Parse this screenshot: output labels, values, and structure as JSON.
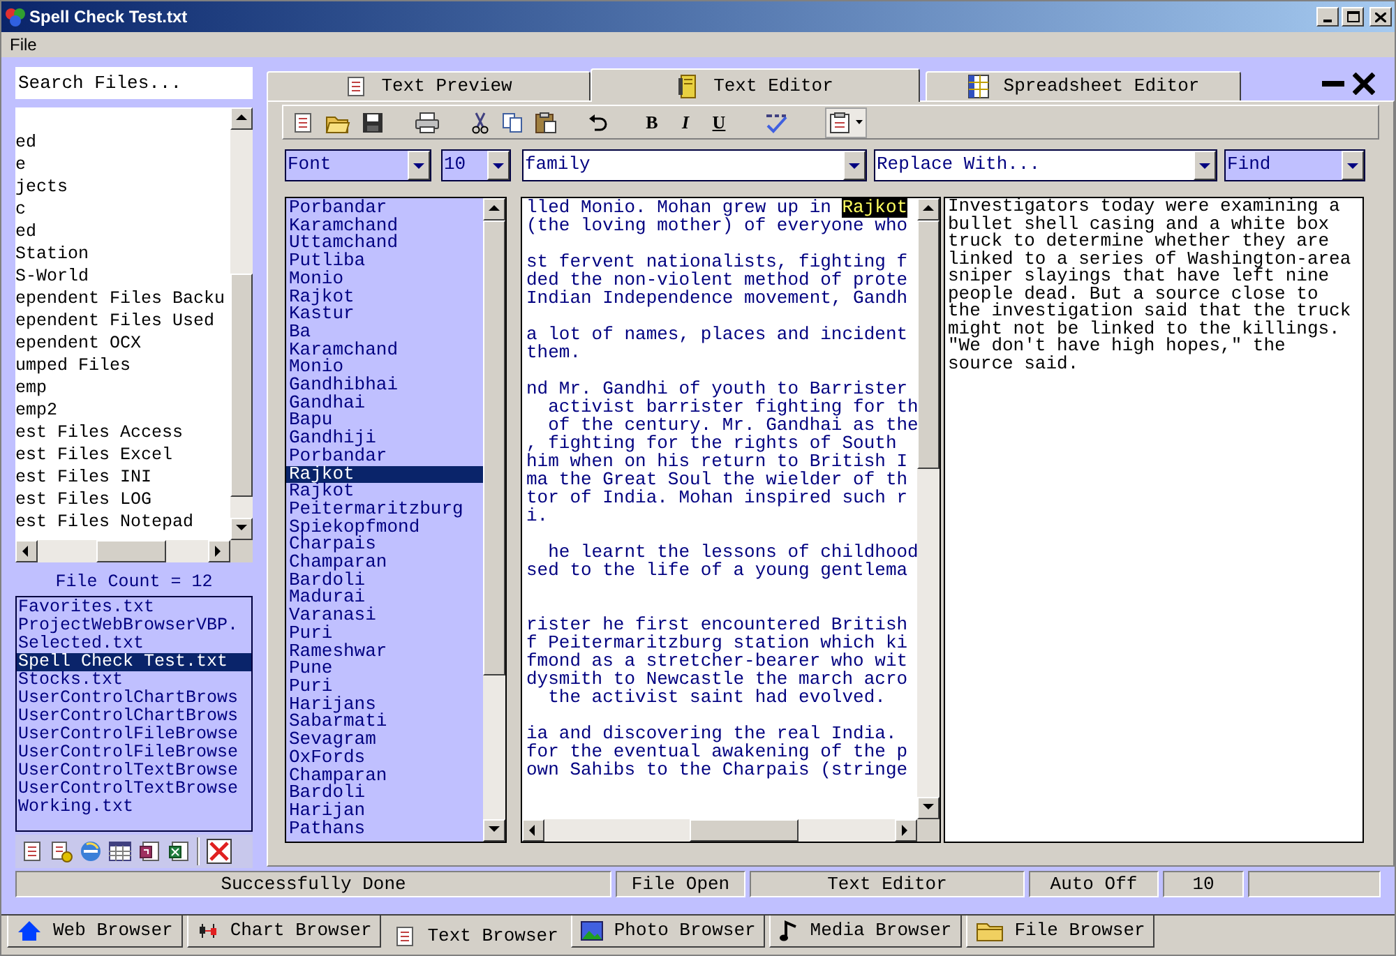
{
  "window": {
    "title": "Spell Check Test.txt"
  },
  "menu": [
    "File"
  ],
  "search": {
    "placeholder": "Search Files..."
  },
  "folder_tree": [
    "ed",
    "e",
    "jects",
    "c",
    "ed",
    "Station",
    "S-World",
    "ependent Files Backu",
    "ependent Files Used",
    "ependent OCX",
    "umped Files",
    "emp",
    "emp2",
    "est Files Access",
    "est Files Excel",
    "est Files INI",
    "est Files LOG",
    "est Files Notepad"
  ],
  "file_count": "File Count = 12",
  "files": [
    {
      "name": "Favorites.txt",
      "selected": false
    },
    {
      "name": "ProjectWebBrowserVBP.",
      "selected": false
    },
    {
      "name": "Selected.txt",
      "selected": false
    },
    {
      "name": "Spell Check Test.txt",
      "selected": true
    },
    {
      "name": "Stocks.txt",
      "selected": false
    },
    {
      "name": "UserControlChartBrows",
      "selected": false
    },
    {
      "name": "UserControlChartBrows",
      "selected": false
    },
    {
      "name": "UserControlFileBrowse",
      "selected": false
    },
    {
      "name": "UserControlFileBrowse",
      "selected": false
    },
    {
      "name": "UserControlTextBrowse",
      "selected": false
    },
    {
      "name": "UserControlTextBrowse",
      "selected": false
    },
    {
      "name": "Working.txt",
      "selected": false
    }
  ],
  "editor_tabs": [
    {
      "label": "Text Preview",
      "selected": false
    },
    {
      "label": "Text Editor",
      "selected": true
    },
    {
      "label": "Spreadsheet Editor",
      "selected": false
    }
  ],
  "format_buttons": [
    "B",
    "I",
    "U"
  ],
  "font_combo": "Font",
  "size_combo": "10",
  "find_text": "family",
  "replace_text": "Replace With...",
  "find_combo": "Find",
  "word_list": [
    {
      "word": "Porbandar",
      "selected": false
    },
    {
      "word": "Karamchand",
      "selected": false
    },
    {
      "word": "Uttamchand",
      "selected": false
    },
    {
      "word": "Putliba",
      "selected": false
    },
    {
      "word": "Monio",
      "selected": false
    },
    {
      "word": "Rajkot",
      "selected": false
    },
    {
      "word": "Kastur",
      "selected": false
    },
    {
      "word": "Ba",
      "selected": false
    },
    {
      "word": "Karamchand",
      "selected": false
    },
    {
      "word": "Monio",
      "selected": false
    },
    {
      "word": "Gandhibhai",
      "selected": false
    },
    {
      "word": "Gandhai",
      "selected": false
    },
    {
      "word": "Bapu",
      "selected": false
    },
    {
      "word": "Gandhiji",
      "selected": false
    },
    {
      "word": "Porbandar",
      "selected": false
    },
    {
      "word": "Rajkot",
      "selected": true
    },
    {
      "word": "Rajkot",
      "selected": false
    },
    {
      "word": "Peitermaritzburg",
      "selected": false
    },
    {
      "word": "Spiekopfmond",
      "selected": false
    },
    {
      "word": "Charpais",
      "selected": false
    },
    {
      "word": "Champaran",
      "selected": false
    },
    {
      "word": "Bardoli",
      "selected": false
    },
    {
      "word": "Madurai",
      "selected": false
    },
    {
      "word": "Varanasi",
      "selected": false
    },
    {
      "word": "Puri",
      "selected": false
    },
    {
      "word": "Rameshwar",
      "selected": false
    },
    {
      "word": "Pune",
      "selected": false
    },
    {
      "word": "Puri",
      "selected": false
    },
    {
      "word": "Harijans",
      "selected": false
    },
    {
      "word": "Sabarmati",
      "selected": false
    },
    {
      "word": "Sevagram",
      "selected": false
    },
    {
      "word": "OxFords",
      "selected": false
    },
    {
      "word": "Champaran",
      "selected": false
    },
    {
      "word": "Bardoli",
      "selected": false
    },
    {
      "word": "Harijan",
      "selected": false
    },
    {
      "word": "Pathans",
      "selected": false
    }
  ],
  "editor_paragraphs": [
    {
      "extra_gap": false,
      "lines": [
        {
          "text": "lled Monio. Mohan grew up in ",
          "highlight": "Rajkot"
        },
        {
          "text": "(the loving mother) of everyone who"
        }
      ]
    },
    {
      "extra_gap": false,
      "lines": [
        {
          "text": "st fervent nationalists, fighting f"
        },
        {
          "text": "ded the non-violent method of prote"
        },
        {
          "text": "Indian Independence movement, Gandh"
        }
      ]
    },
    {
      "extra_gap": false,
      "lines": [
        {
          "text": "a lot of names, places and incident"
        },
        {
          "text": "them."
        }
      ]
    },
    {
      "extra_gap": false,
      "lines": [
        {
          "text": "nd Mr. Gandhi of youth to Barrister"
        },
        {
          "text": "  activist barrister fighting for th"
        },
        {
          "text": "  of the century. Mr. Gandhai as the"
        },
        {
          "text": ", fighting for the rights of South"
        },
        {
          "text": "him when on his return to British I"
        },
        {
          "text": "ma the Great Soul the wielder of th"
        },
        {
          "text": "tor of India. Mohan inspired such r"
        },
        {
          "text": "i."
        }
      ]
    },
    {
      "extra_gap": false,
      "lines": [
        {
          "text": "  he learnt the lessons of childhood"
        },
        {
          "text": "sed to the life of a young gentlema"
        }
      ]
    },
    {
      "extra_gap": true,
      "lines": [
        {
          "text": "rister he first encountered British"
        },
        {
          "text": "f Peitermaritzburg station which ki"
        },
        {
          "text": "fmond as a stretcher-bearer who wit"
        },
        {
          "text": "dysmith to Newcastle the march acro"
        },
        {
          "text": "  the activist saint had evolved."
        }
      ]
    },
    {
      "extra_gap": false,
      "lines": [
        {
          "text": "ia and discovering the real India."
        },
        {
          "text": "for the eventual awakening of the p"
        },
        {
          "text": "own Sahibs to the Charpais (stringe"
        }
      ]
    }
  ],
  "preview_lines": [
    "Investigators today were examining a",
    "bullet shell casing and a white box",
    "truck to determine whether they are",
    "linked to a series of Washington-area",
    "sniper slayings that have left nine",
    "people dead. But a source close to",
    "the investigation said that the truck",
    "might not be linked to the killings.",
    "\"We don't have high hopes,\" the",
    "source said."
  ],
  "status_bar": [
    "Successfully Done",
    "File Open",
    "Text Editor",
    "Auto Off",
    "10"
  ],
  "taskbar_tabs": [
    {
      "label": "Web Browser",
      "selected": false
    },
    {
      "label": "Chart Browser",
      "selected": false
    },
    {
      "label": "Text Browser",
      "selected": true
    },
    {
      "label": "Photo Browser",
      "selected": false
    },
    {
      "label": "Media Browser",
      "selected": false
    },
    {
      "label": "File Browser",
      "selected": false
    }
  ]
}
